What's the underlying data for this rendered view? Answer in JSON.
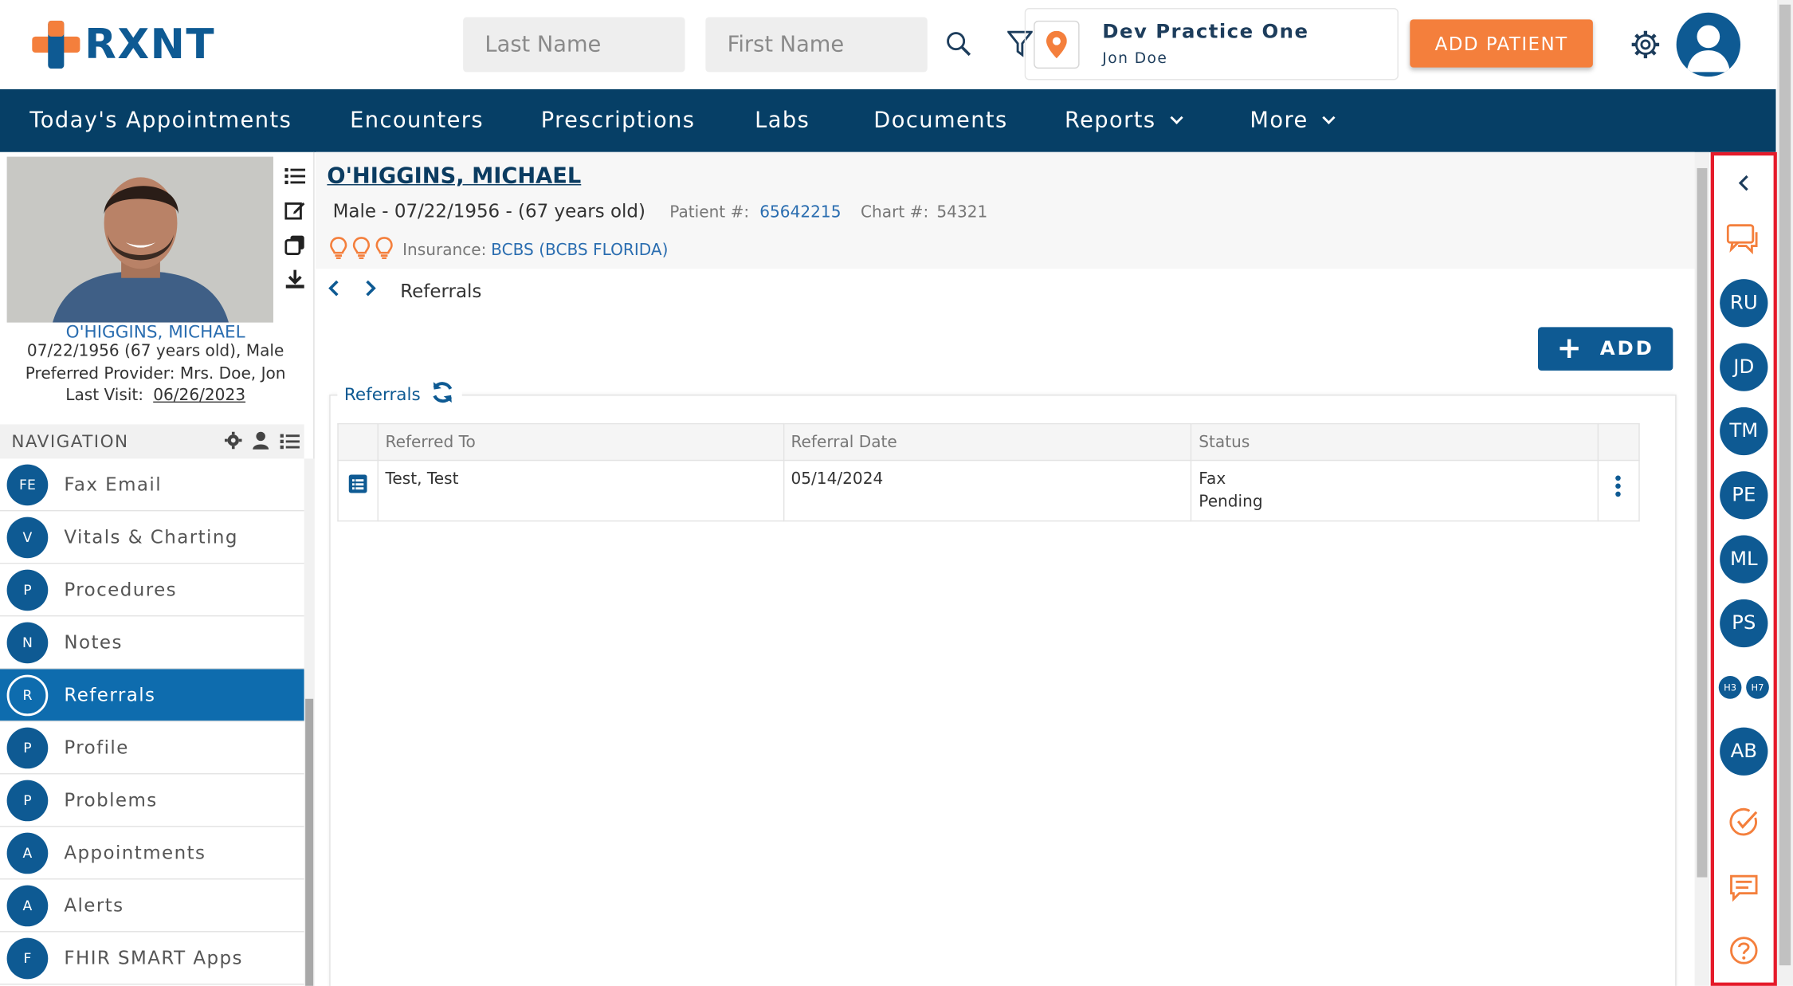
{
  "brand": {
    "logo_text": "RXNT",
    "accent": "#f47f3c",
    "primary": "#0e5a93",
    "nav_bg": "#063f66"
  },
  "header": {
    "last_name_placeholder": "Last Name",
    "first_name_placeholder": "First Name",
    "practice_name": "Dev Practice One",
    "practice_user": "Jon Doe",
    "add_patient_label": "ADD PATIENT",
    "icons": [
      "search-icon",
      "filter-icon",
      "location-pin-icon",
      "gear-icon",
      "user-avatar-icon"
    ]
  },
  "nav": {
    "items": [
      {
        "label": "Today's Appointments"
      },
      {
        "label": "Encounters"
      },
      {
        "label": "Prescriptions"
      },
      {
        "label": "Labs"
      },
      {
        "label": "Documents"
      },
      {
        "label": "Reports"
      },
      {
        "label": "More"
      }
    ]
  },
  "patient_card": {
    "name": "O'HIGGINS, MICHAEL",
    "dob_line": "07/22/1956 (67 years old), Male",
    "provider_line": "Preferred Provider: Mrs. Doe, Jon",
    "last_visit_label": "Last Visit:",
    "last_visit_date": "06/26/2023"
  },
  "navigation": {
    "title": "NAVIGATION",
    "items": [
      {
        "badge": "FE",
        "label": "Fax Email"
      },
      {
        "badge": "V",
        "label": "Vitals & Charting"
      },
      {
        "badge": "P",
        "label": "Procedures"
      },
      {
        "badge": "N",
        "label": "Notes"
      },
      {
        "badge": "R",
        "label": "Referrals",
        "active": true
      },
      {
        "badge": "P",
        "label": "Profile"
      },
      {
        "badge": "P",
        "label": "Problems"
      },
      {
        "badge": "A",
        "label": "Appointments"
      },
      {
        "badge": "A",
        "label": "Alerts"
      },
      {
        "badge": "F",
        "label": "FHIR SMART Apps"
      }
    ]
  },
  "patient_header": {
    "name": "O'HIGGINS, MICHAEL",
    "demographics": "Male - 07/22/1956 - (67 years old)",
    "patient_num_label": "Patient #:",
    "patient_num": "65642215",
    "chart_num_label": "Chart #:",
    "chart_num": "54321",
    "insurance_label": "Insurance:",
    "insurance_value": "BCBS (BCBS FLORIDA)"
  },
  "breadcrumb": {
    "title": "Referrals"
  },
  "referrals": {
    "add_label": "ADD",
    "panel_title": "Referrals",
    "columns": [
      "Referred To",
      "Referral Date",
      "Status"
    ],
    "rows": [
      {
        "referred_to": "Test, Test",
        "date": "05/14/2024",
        "status_line1": "Fax",
        "status_line2": "Pending"
      }
    ]
  },
  "right_rail": {
    "avatars": [
      "RU",
      "JD",
      "TM",
      "PE",
      "ML",
      "PS"
    ],
    "mini_avatars": [
      "H3",
      "H7"
    ],
    "last_avatar": "AB",
    "icons": [
      "collapse-chevron-icon",
      "chat-bubbles-icon",
      "tasks-check-icon",
      "message-icon",
      "help-icon"
    ]
  }
}
